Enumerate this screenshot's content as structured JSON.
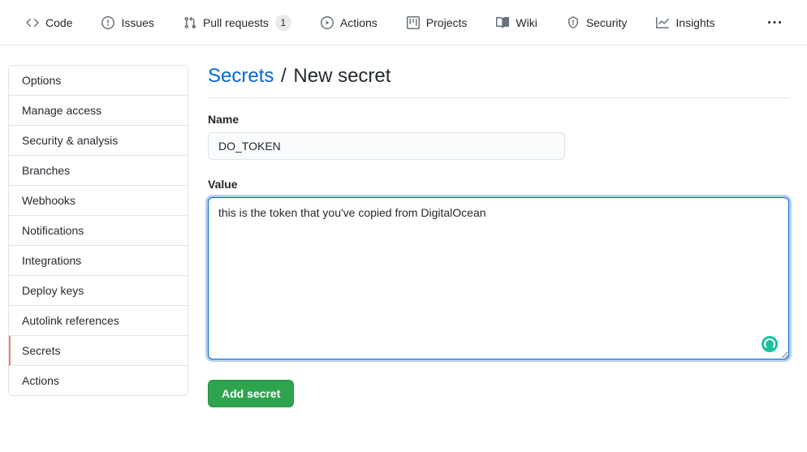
{
  "nav": {
    "code": "Code",
    "issues": "Issues",
    "pull_requests": "Pull requests",
    "pull_requests_count": "1",
    "actions": "Actions",
    "projects": "Projects",
    "wiki": "Wiki",
    "security": "Security",
    "insights": "Insights"
  },
  "sidebar": {
    "items": [
      "Options",
      "Manage access",
      "Security & analysis",
      "Branches",
      "Webhooks",
      "Notifications",
      "Integrations",
      "Deploy keys",
      "Autolink references",
      "Secrets",
      "Actions"
    ]
  },
  "heading": {
    "parent": "Secrets",
    "separator": "/",
    "current": "New secret"
  },
  "form": {
    "name_label": "Name",
    "name_value": "DO_TOKEN",
    "value_label": "Value",
    "value_text": "this is the token that you've copied from DigitalOcean",
    "submit_label": "Add secret"
  }
}
